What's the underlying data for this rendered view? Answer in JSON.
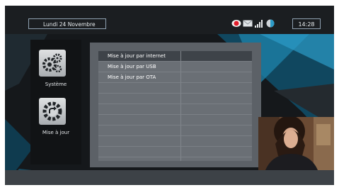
{
  "header": {
    "date": "Lundi 24 Novembre",
    "time": "14:28",
    "status_icons": [
      "record-icon",
      "mail-icon",
      "signal-bars-icon",
      "network-icon"
    ]
  },
  "sidebar": {
    "items": [
      {
        "label": "Système",
        "icon": "gears-icon"
      },
      {
        "label": "Mise à jour",
        "icon": "update-gear-icon"
      }
    ]
  },
  "menu": {
    "items": [
      {
        "label": "Mise à jour par internet",
        "selected": true
      },
      {
        "label": "Mise à jour par USB",
        "selected": false
      },
      {
        "label": "Mise à jour par OTA",
        "selected": false
      }
    ]
  },
  "colors": {
    "accent": "#2c9bc7",
    "record": "#e21d2b",
    "selected_row": "#3e4349"
  }
}
